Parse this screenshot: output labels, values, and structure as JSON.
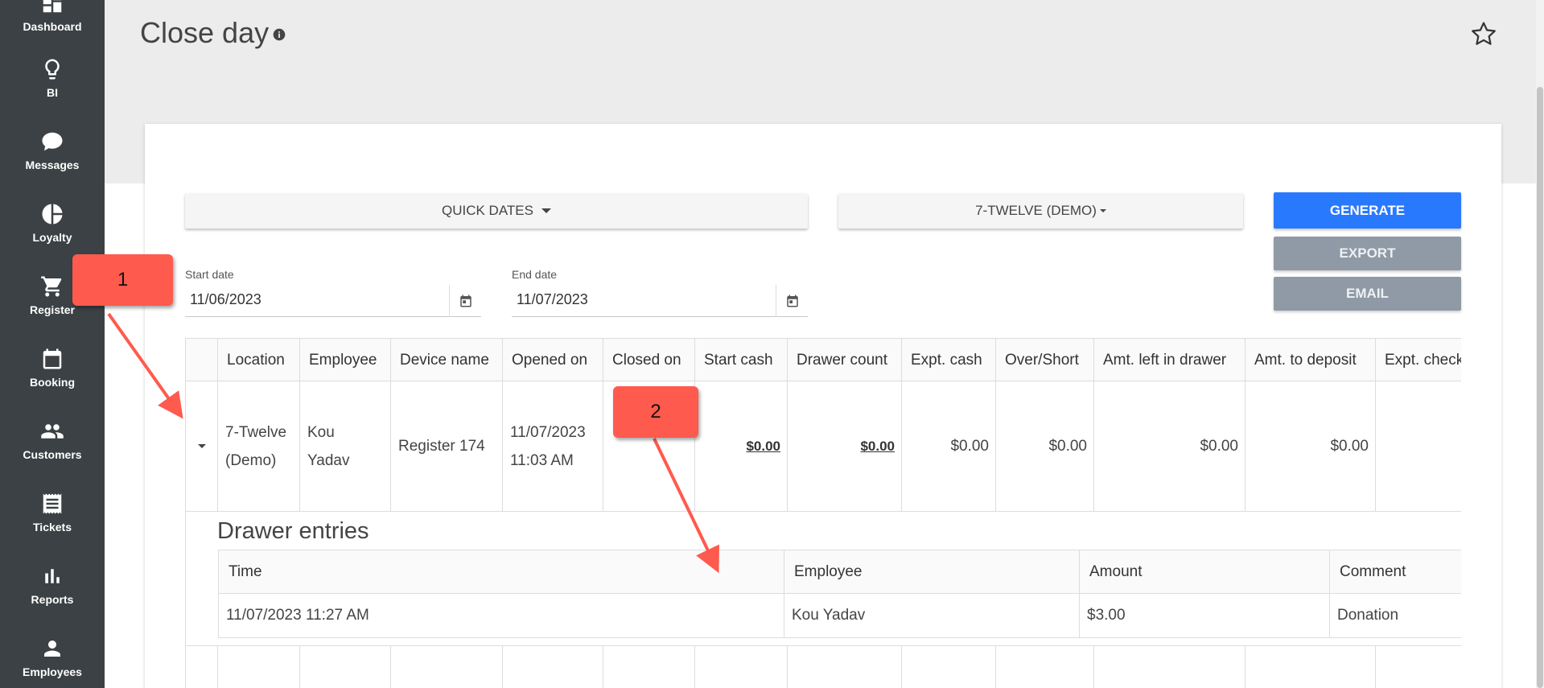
{
  "sidebar": {
    "items": [
      {
        "label": "Dashboard",
        "icon": "dashboard-icon"
      },
      {
        "label": "BI",
        "icon": "lightbulb-icon"
      },
      {
        "label": "Messages",
        "icon": "chat-bubble-icon"
      },
      {
        "label": "Loyalty",
        "icon": "pie-chart-icon"
      },
      {
        "label": "Register",
        "icon": "cart-icon"
      },
      {
        "label": "Booking",
        "icon": "calendar-icon"
      },
      {
        "label": "Customers",
        "icon": "people-icon"
      },
      {
        "label": "Tickets",
        "icon": "receipt-icon"
      },
      {
        "label": "Reports",
        "icon": "bar-chart-icon"
      },
      {
        "label": "Employees",
        "icon": "person-icon"
      }
    ]
  },
  "header": {
    "title": "Close day"
  },
  "filters": {
    "quick_dates_label": "QUICK DATES",
    "location_label": "7-TWELVE (DEMO)",
    "start_date_label": "Start date",
    "start_date_value": "11/06/2023",
    "end_date_label": "End date",
    "end_date_value": "11/07/2023"
  },
  "actions": {
    "generate_label": "GENERATE",
    "export_label": "EXPORT",
    "email_label": "EMAIL"
  },
  "table": {
    "columns": [
      "Location",
      "Employee",
      "Device name",
      "Opened on",
      "Closed on",
      "Start cash",
      "Drawer count",
      "Expt. cash",
      "Over/Short",
      "Amt. left in drawer",
      "Amt. to deposit",
      "Expt. check"
    ],
    "row": {
      "location_line1": "7-Twelve",
      "location_line2": "(Demo)",
      "employee_line1": "Kou",
      "employee_line2": "Yadav",
      "device_name": "Register 174",
      "opened_on_line1": "11/07/2023",
      "opened_on_line2": "11:03 AM",
      "closed_on": "",
      "start_cash": "$0.00",
      "drawer_count": "$0.00",
      "expt_cash": "$0.00",
      "over_short": "$0.00",
      "amt_left_in_drawer": "$0.00",
      "amt_to_deposit": "$0.00"
    }
  },
  "drawer_entries": {
    "title": "Drawer entries",
    "columns": [
      "Time",
      "Employee",
      "Amount",
      "Comment"
    ],
    "rows": [
      {
        "time": "11/07/2023 11:27 AM",
        "employee": "Kou Yadav",
        "amount": "$3.00",
        "comment": "Donation"
      }
    ]
  },
  "annotations": {
    "box1": "1",
    "box2": "2",
    "color": "#ff5a4e"
  },
  "colors": {
    "sidebar_bg": "#3b4144",
    "primary": "#2979ff",
    "secondary": "#8f9aa6"
  }
}
